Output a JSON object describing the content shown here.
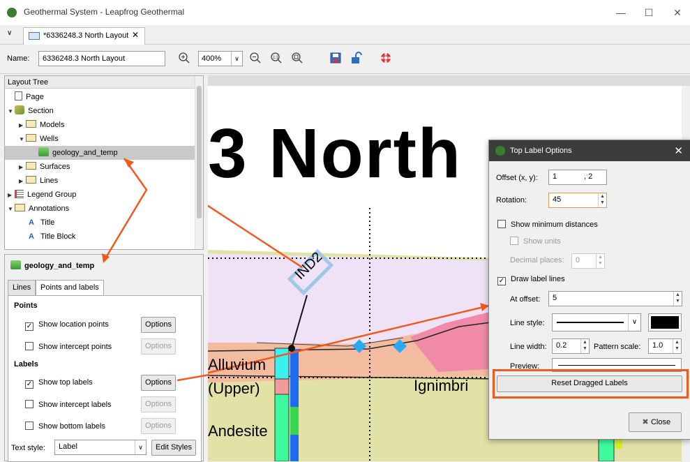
{
  "window": {
    "title": "Geothermal System - Leapfrog Geothermal",
    "minimize": "—",
    "maximize": "☐",
    "close": "✕"
  },
  "tabs": {
    "dropdown": "∨",
    "items": [
      {
        "label": "*6336248.3 North Layout",
        "close": "✕"
      }
    ]
  },
  "toolbar": {
    "name_label": "Name:",
    "name_value": "6336248.3 North Layout",
    "zoom_value": "400%",
    "zoom_arrow": "∨"
  },
  "layout_tree": {
    "header": "Layout Tree",
    "items": [
      {
        "label": "Page"
      },
      {
        "label": "Section",
        "arrow": "▼"
      },
      {
        "label": "Models",
        "arrow": "▶"
      },
      {
        "label": "Wells",
        "arrow": "▼"
      },
      {
        "label": "geology_and_temp"
      },
      {
        "label": "Surfaces",
        "arrow": "▶"
      },
      {
        "label": "Lines",
        "arrow": "▶"
      },
      {
        "label": "Legend Group",
        "arrow": "▶"
      },
      {
        "label": "Annotations",
        "arrow": "▼"
      },
      {
        "label": "Title"
      },
      {
        "label": "Title Block"
      }
    ]
  },
  "properties": {
    "title": "geology_and_temp",
    "tabs": [
      {
        "label": "Lines"
      },
      {
        "label": "Points and labels"
      }
    ],
    "points_header": "Points",
    "show_location_points": "Show location points",
    "show_intercept_points": "Show intercept points",
    "labels_header": "Labels",
    "show_top_labels": "Show top labels",
    "show_intercept_labels": "Show intercept labels",
    "show_bottom_labels": "Show bottom labels",
    "options": "Options",
    "text_style_label": "Text style:",
    "text_style_value": "Label",
    "edit_styles": "Edit Styles",
    "check_mark": "✓"
  },
  "canvas": {
    "big_title": "3 North",
    "well_label": "IND2",
    "units": [
      "Alluvium",
      "(Upper)",
      "Ignimbri",
      "Andesite"
    ]
  },
  "dialog": {
    "title": "Top Label Options",
    "close": "✕",
    "offset_label": "Offset (x, y):",
    "offset_x": "1",
    "offset_y": ", 2",
    "rotation_label": "Rotation:",
    "rotation_value": "45",
    "show_min_dist": "Show minimum distances",
    "show_units": "Show units",
    "decimal_places_label": "Decimal places:",
    "decimal_places_value": "0",
    "draw_label_lines": "Draw label lines",
    "at_offset_label": "At offset:",
    "at_offset_value": "5",
    "line_style_label": "Line style:",
    "line_width_label": "Line width:",
    "line_width_value": "0.2",
    "pattern_scale_label": "Pattern scale:",
    "pattern_scale_value": "1.0",
    "preview_label": "Preview:",
    "reset_button": "Reset Dragged Labels",
    "close_button": "Close",
    "line_color": "#000000"
  },
  "colors": {
    "accent": "#f05a1e",
    "zone_purple": "#efe2f7",
    "zone_salmon": "#f4bba0",
    "zone_pink": "#f08aa8",
    "zone_green": "#e3e3a8"
  }
}
